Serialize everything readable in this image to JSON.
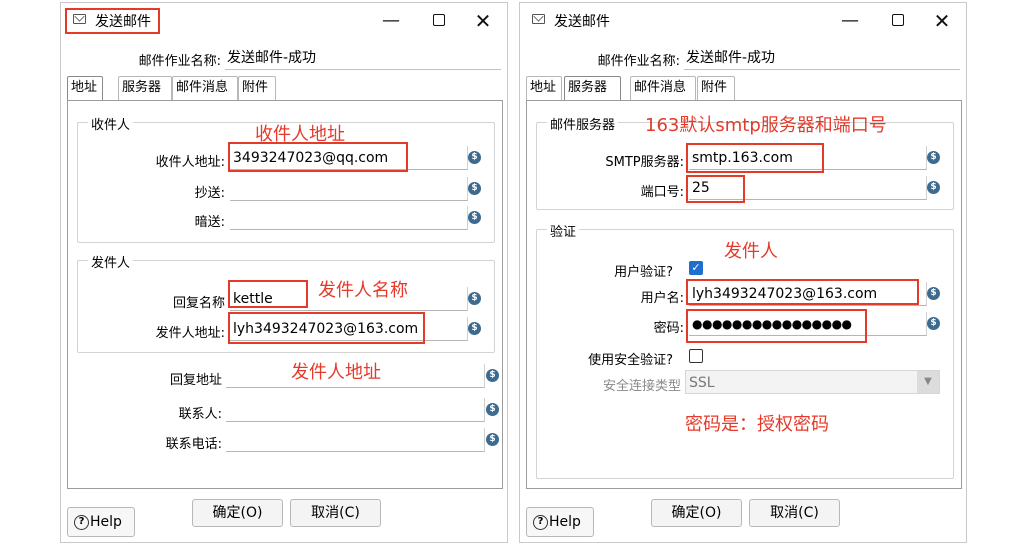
{
  "left": {
    "window_title": "发送邮件",
    "job_label": "邮件作业名称:",
    "job_value": "发送邮件-成功",
    "tabs": [
      "地址",
      "服务器",
      "邮件消息",
      "附件"
    ],
    "recipient_group": "收件人",
    "recipient_fields": [
      {
        "label": "收件人地址:",
        "value": "3493247023@qq.com"
      },
      {
        "label": "抄送:",
        "value": ""
      },
      {
        "label": "暗送:",
        "value": ""
      }
    ],
    "sender_group": "发件人",
    "sender_fields": [
      {
        "label": "回复名称",
        "value": "kettle"
      },
      {
        "label": "发件人地址:",
        "value": "lyh3493247023@163.com"
      }
    ],
    "other_fields": [
      {
        "label": "回复地址",
        "value": ""
      },
      {
        "label": "联系人:",
        "value": ""
      },
      {
        "label": "联系电话:",
        "value": ""
      }
    ],
    "annotations": {
      "recipient_addr": "收件人地址",
      "sender_name": "发件人名称",
      "sender_addr": "发件人地址"
    },
    "ok": "确定(O)",
    "cancel": "取消(C)",
    "help": "Help"
  },
  "right": {
    "window_title": "发送邮件",
    "job_label": "邮件作业名称:",
    "job_value": "发送邮件-成功",
    "tabs": [
      "地址",
      "服务器",
      "邮件消息",
      "附件"
    ],
    "server_group": "邮件服务器",
    "smtp_label": "SMTP服务器:",
    "smtp_value": "smtp.163.com",
    "port_label": "端口号:",
    "port_value": "25",
    "auth_group": "验证",
    "user_auth_label": "用户验证?",
    "user_label": "用户名:",
    "user_value": "lyh3493247023@163.com",
    "pwd_label": "密码:",
    "pwd_value": "●●●●●●●●●●●●●●●●",
    "secure_label": "使用安全验证?",
    "secure_type_label": "安全连接类型",
    "secure_type_value": "SSL",
    "annotations": {
      "server": "163默认smtp服务器和端口号",
      "sender": "发件人",
      "password": "密码是：授权密码"
    },
    "ok": "确定(O)",
    "cancel": "取消(C)",
    "help": "Help"
  },
  "icons": {
    "variable": "dollar-variable-icon",
    "mail": "mail-icon"
  },
  "colors": {
    "highlight": "#e53a2a",
    "checkbox": "#1f6fd1",
    "variable_icon": "#3d6a8f"
  }
}
